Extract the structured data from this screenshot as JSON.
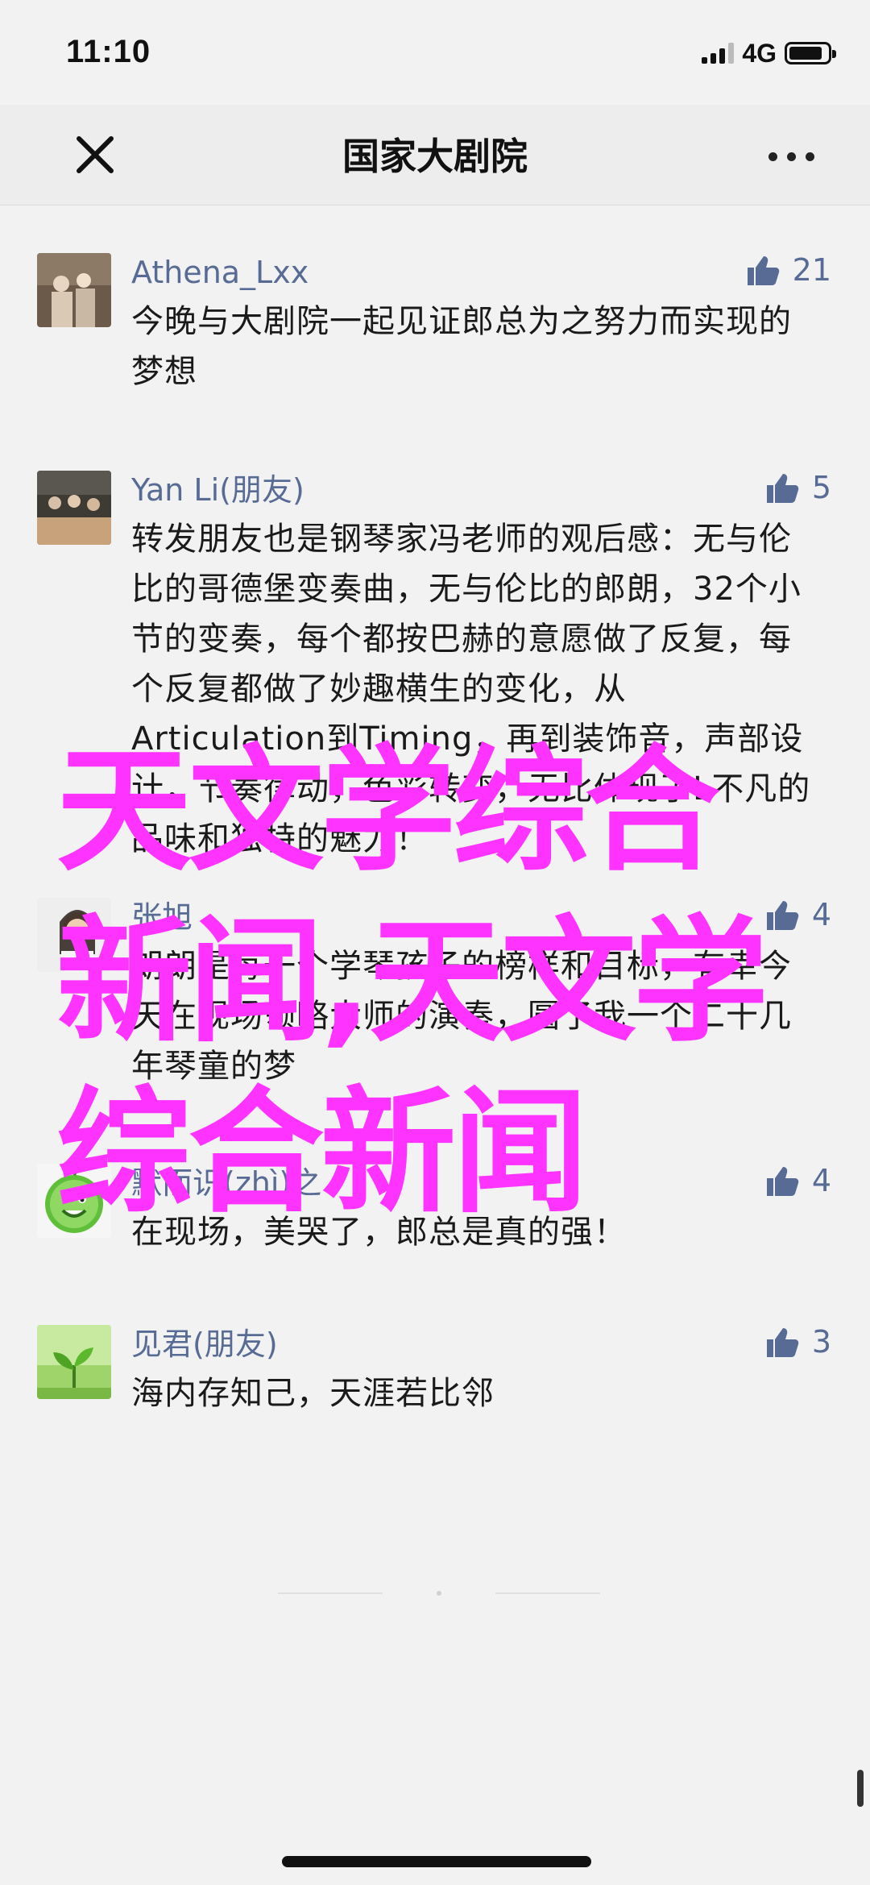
{
  "status": {
    "time": "11:10",
    "network": "4G"
  },
  "nav": {
    "title": "国家大剧院"
  },
  "comments": [
    {
      "name": "Athena_Lxx",
      "text": "今晚与大剧院一起见证郎总为之努力而实现的梦想",
      "likes": "21"
    },
    {
      "name": "Yan Li(朋友)",
      "text": "转发朋友也是钢琴家冯老师的观后感：无与伦比的哥德堡变奏曲，无与伦比的郎朗，32个小节的变奏，每个都按巴赫的意愿做了反复，每个反复都做了妙趣横生的变化，从Articulation到Timing，再到装饰音，声部设计，节奏律动，色彩转变，无比体现了L不凡的品味和独特的魅力！",
      "likes": "5"
    },
    {
      "name": "张旭",
      "text": "朗朗是每一个学琴孩子的榜样和目标，有幸今天在现场领略大师的演奏，圆了我一个二十几年琴童的梦",
      "likes": "4"
    },
    {
      "name": "默而识(zhì)之",
      "text": "在现场，美哭了，郎总是真的强！",
      "likes": "4"
    },
    {
      "name": "见君(朋友)",
      "text": "海内存知己，天涯若比邻",
      "likes": "3"
    }
  ],
  "watermark": "天文学综合新闻,天文学综合新闻",
  "colors": {
    "name": "#576b95",
    "watermark": "#ff33ff",
    "background": "#f2f2f2"
  }
}
